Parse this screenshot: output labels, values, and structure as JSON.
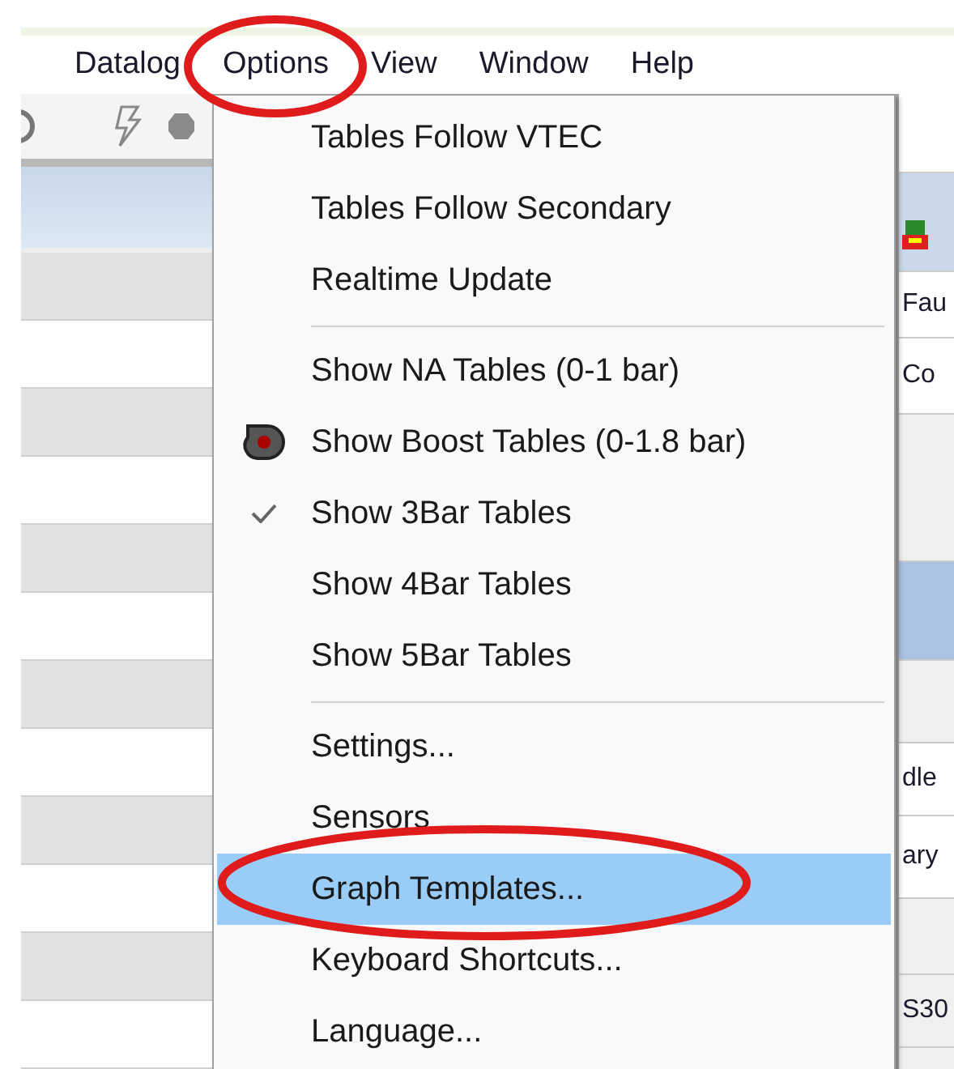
{
  "menubar": [
    {
      "label": "Datalog"
    },
    {
      "label": "Options"
    },
    {
      "label": "View"
    },
    {
      "label": "Window"
    },
    {
      "label": "Help"
    }
  ],
  "menu": {
    "items": [
      {
        "kind": "item",
        "label": "Tables Follow VTEC",
        "checked": false,
        "selected": false
      },
      {
        "kind": "item",
        "label": "Tables Follow Secondary",
        "checked": false,
        "selected": false
      },
      {
        "kind": "item",
        "label": "Realtime Update",
        "checked": false,
        "selected": false
      },
      {
        "kind": "separator"
      },
      {
        "kind": "item",
        "label": "Show NA Tables (0-1 bar)",
        "checked": false,
        "selected": false
      },
      {
        "kind": "icon",
        "label": "Show Boost Tables (0-1.8 bar)",
        "checked": false,
        "selected": false
      },
      {
        "kind": "item",
        "label": "Show 3Bar Tables",
        "checked": true,
        "selected": false
      },
      {
        "kind": "item",
        "label": "Show 4Bar Tables",
        "checked": false,
        "selected": false
      },
      {
        "kind": "item",
        "label": "Show 5Bar Tables",
        "checked": false,
        "selected": false
      },
      {
        "kind": "separator"
      },
      {
        "kind": "item",
        "label": "Settings...",
        "checked": false,
        "selected": false
      },
      {
        "kind": "item",
        "label": "Sensors",
        "checked": false,
        "selected": false
      },
      {
        "kind": "item",
        "label": "Graph Templates...",
        "checked": false,
        "selected": true
      },
      {
        "kind": "item",
        "label": "Keyboard Shortcuts...",
        "checked": false,
        "selected": false
      },
      {
        "kind": "item",
        "label": "Language...",
        "checked": false,
        "selected": false
      }
    ]
  },
  "right_panel": [
    {
      "text": "Fau"
    },
    {
      "text": "Co"
    },
    {
      "text": "dle"
    },
    {
      "text": "ary"
    },
    {
      "text": "S30"
    }
  ]
}
